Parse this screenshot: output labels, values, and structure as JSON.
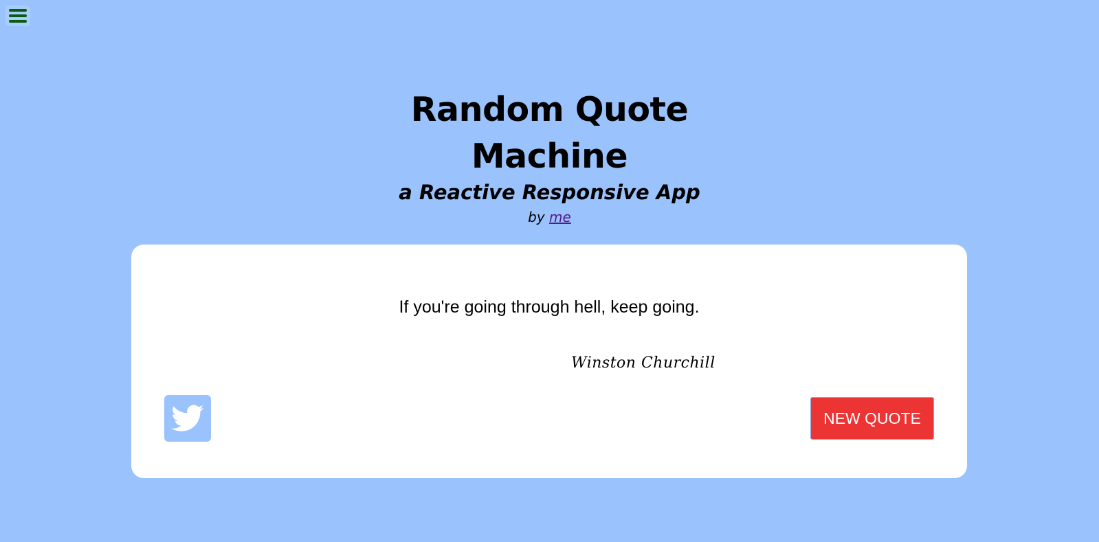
{
  "header": {
    "title": "Random Quote Machine",
    "subtitle": "a Reactive Responsive App",
    "byline_prefix": "by",
    "byline_link": "me"
  },
  "quote": {
    "text": "If you're going through hell, keep going.",
    "author": "Winston Churchill"
  },
  "actions": {
    "new_quote_label": "NEW QUOTE"
  },
  "icons": {
    "menu": "hamburger-menu-icon",
    "tweet": "twitter-bird-icon"
  },
  "colors": {
    "background": "#9ac2fd",
    "card": "#ffffff",
    "button": "#ed3434",
    "menu_bars": "#0a5a16",
    "link": "#551a8b"
  }
}
